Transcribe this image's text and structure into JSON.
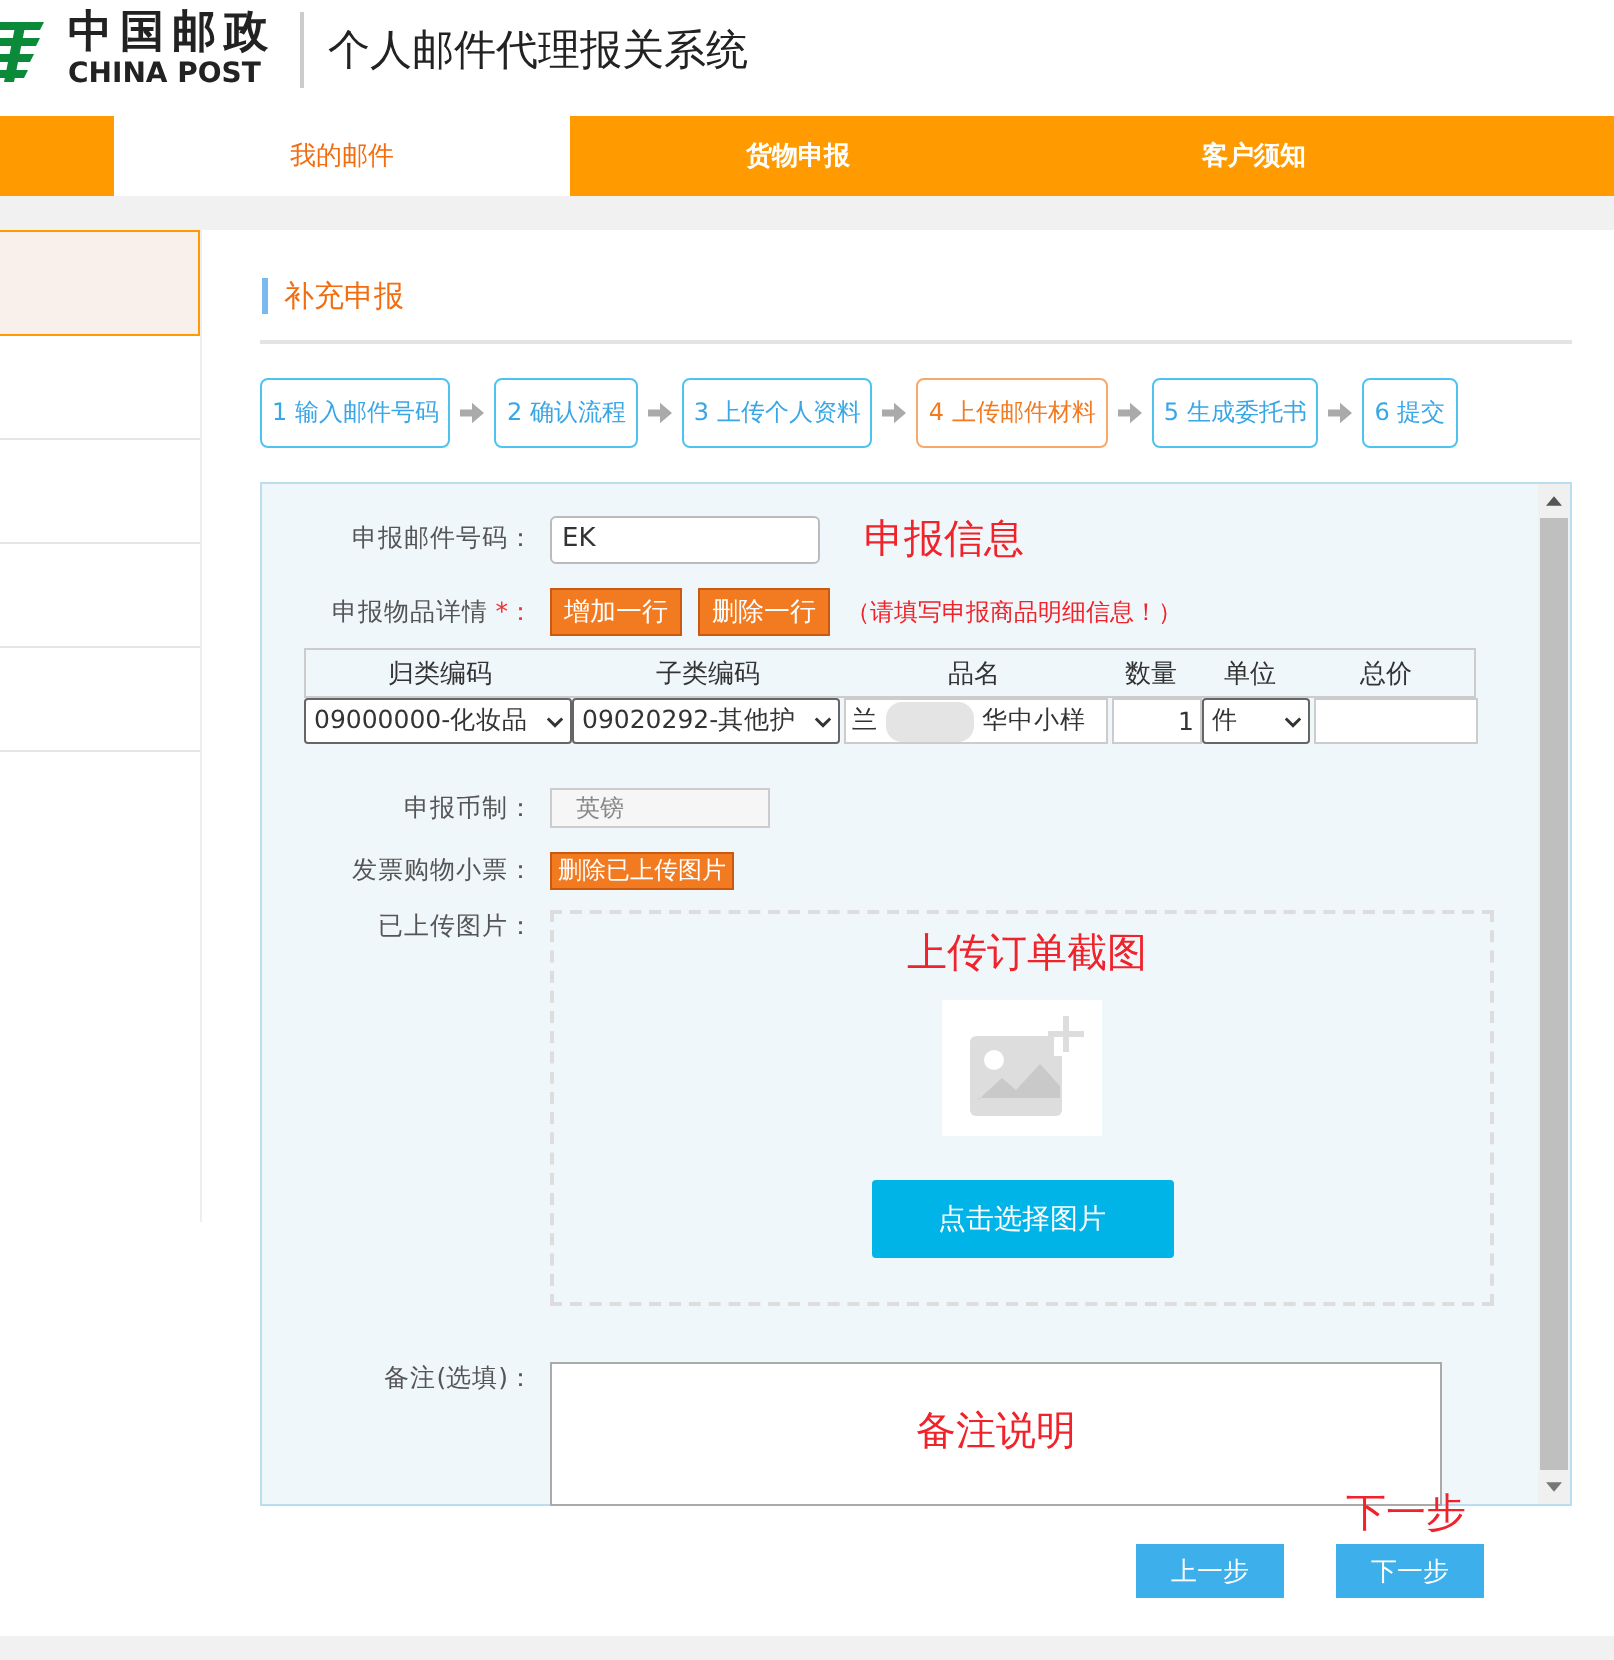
{
  "header": {
    "logo_cn": "中国邮政",
    "logo_en": "CHINA POST",
    "system_title": "个人邮件代理报关系统"
  },
  "nav_tabs": [
    {
      "label": "我的邮件",
      "selected": true
    },
    {
      "label": "货物申报",
      "selected": false
    },
    {
      "label": "客户须知",
      "selected": false
    }
  ],
  "sidebar": {
    "items": [
      {
        "selected": true
      },
      {
        "selected": false
      },
      {
        "selected": false
      },
      {
        "selected": false
      },
      {
        "selected": false
      }
    ]
  },
  "section_title": "补充申报",
  "steps": [
    {
      "label": "1 输入邮件号码",
      "selected": false
    },
    {
      "label": "2 确认流程",
      "selected": false
    },
    {
      "label": "3 上传个人资料",
      "selected": false
    },
    {
      "label": "4 上传邮件材料",
      "selected": true
    },
    {
      "label": "5 生成委托书",
      "selected": false
    },
    {
      "label": "6 提交",
      "selected": false
    }
  ],
  "form": {
    "mail_number": {
      "label": "申报邮件号码：",
      "value": "EK",
      "annotation": "申报信息"
    },
    "items": {
      "label": "申报物品详情",
      "required_mark": "*：",
      "buttons": [
        "增加一行",
        "删除一行"
      ],
      "hint": "（请填写申报商品明细信息！）",
      "columns": [
        "归类编码",
        "子类编码",
        "品名",
        "数量",
        "单位",
        "总价"
      ],
      "row": {
        "category": "09000000-化妆品",
        "subcategory": "09020292-其他护",
        "name_start": "兰",
        "name_end": "华中小样",
        "quantity": "1",
        "unit": "件"
      }
    },
    "currency": {
      "label": "申报币制：",
      "value": "英镑",
      "disabled": true
    },
    "receipt": {
      "label": "发票购物小票：",
      "button": "删除已上传图片"
    },
    "uploaded": {
      "label": "已上传图片：",
      "annotation": "上传订单截图",
      "choose_button": "点击选择图片"
    },
    "remark": {
      "label": "备注(选填)：",
      "annotation": "备注说明"
    }
  },
  "footer_annotation": "下一步",
  "buttons": [
    "上一步",
    "下一步"
  ]
}
